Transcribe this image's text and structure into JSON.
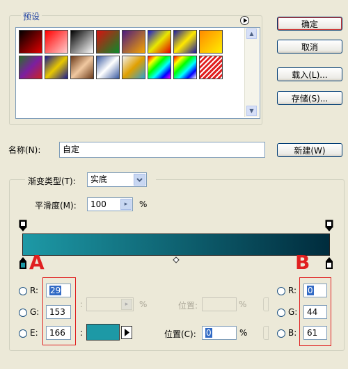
{
  "presets": {
    "title": "预设",
    "swatches": [
      "linear-gradient(135deg,#000 0%,#e00000 100%)",
      "linear-gradient(135deg,#ff0000 0%,rgba(255,0,0,0.2) 100%)",
      "linear-gradient(135deg,#000 0%,#fff 100%)",
      "linear-gradient(135deg,#d81010 0%,#0a8a2a 100%)",
      "linear-gradient(135deg,#4b1a80 0%,#f7a600 100%)",
      "linear-gradient(135deg,#1717d0 0%,#e8e800 50%,#e00000 100%)",
      "linear-gradient(135deg,#1a1aa0 0%,#ffe800 50%,#1a1aa0 100%)",
      "linear-gradient(135deg,#ff8a00 0%,#ffee00 100%)",
      "linear-gradient(135deg,#2b6e2b 0%,#7b1fa0 50%,#c22 100%)",
      "linear-gradient(135deg,#1a1a90 0%,#e8c800 50%,#1a1a90 100%)",
      "linear-gradient(135deg,#6b3a1a 0%,#f0c8a0 50%,#6b3a1a 100%)",
      "linear-gradient(135deg,#3a5aa0 0%,#ffffff 50%,#3a5aa0 100%)",
      "linear-gradient(135deg,#f0f0f0 0%,#e0a000 50%,#30a0d0 100%)",
      "linear-gradient(135deg,#f00 0%,#ff0 20%,#0f0 40%,#0ff 60%,#00f 80%,#f0f 100%)",
      "linear-gradient(135deg,#f00 0%,#ff0 20%,#0f0 40%,#0ff 60%,#00f 80%,rgba(255,255,255,0.3) 100%)",
      "repeating-linear-gradient(135deg,#e02020 0px,#e02020 3px,#ffffff 3px,#ffffff 5px)"
    ]
  },
  "buttons": {
    "ok": "确定",
    "cancel": "取消",
    "load": "载入(L)...",
    "save": "存储(S)...",
    "new": "新建(W)"
  },
  "name": {
    "label": "名称(N):",
    "value": "自定"
  },
  "gradient": {
    "type_label": "渐变类型(T):",
    "type_value": "实底",
    "smooth_label": "平滑度(M):",
    "smooth_value": "100",
    "smooth_unit": "%",
    "bar_colors": [
      "#1d99a6",
      "#002c3d"
    ]
  },
  "left_rgb": {
    "r_label": "R:",
    "r_value": "29",
    "g_label": "G:",
    "g_value": "153",
    "b_label": "E:",
    "b_value": "166",
    "colon": ":",
    "swatch_color": "#1d99a6"
  },
  "right_rgb": {
    "r_label": "R:",
    "r_value": "0",
    "g_label": "G:",
    "g_value": "44",
    "b_label": "B:",
    "b_value": "61"
  },
  "opacity_row": {
    "colon": ":",
    "unit": "%",
    "position_label": "位置:",
    "position_unit": "%"
  },
  "color_row": {
    "position_label": "位置(C):",
    "position_value": "0",
    "position_unit": "%"
  },
  "annotations": {
    "a": "A",
    "b": "B"
  }
}
